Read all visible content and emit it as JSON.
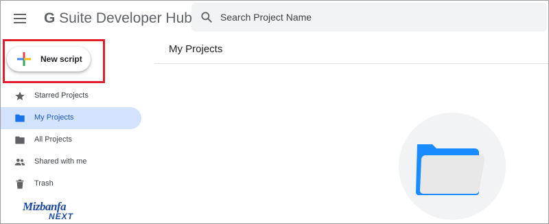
{
  "header": {
    "brand_g": "G",
    "brand_rest": " Suite Developer Hub",
    "search_placeholder": "Search Project Name"
  },
  "sidebar": {
    "new_button_label": "New script",
    "items": [
      {
        "label": "Starred Projects",
        "icon": "star-icon"
      },
      {
        "label": "My Projects",
        "icon": "folder-icon",
        "active": true
      },
      {
        "label": "All Projects",
        "icon": "folder-icon"
      },
      {
        "label": "Shared with me",
        "icon": "people-icon"
      },
      {
        "label": "Trash",
        "icon": "trash-icon"
      }
    ]
  },
  "main": {
    "title": "My Projects"
  },
  "watermark": {
    "line1": "Mizbanfa",
    "line2": "NEXT"
  },
  "colors": {
    "active_bg": "#d3e3fd",
    "active_text": "#1a56c8",
    "highlight_border": "#e11d2b",
    "folder_blue": "#1a8cff"
  }
}
